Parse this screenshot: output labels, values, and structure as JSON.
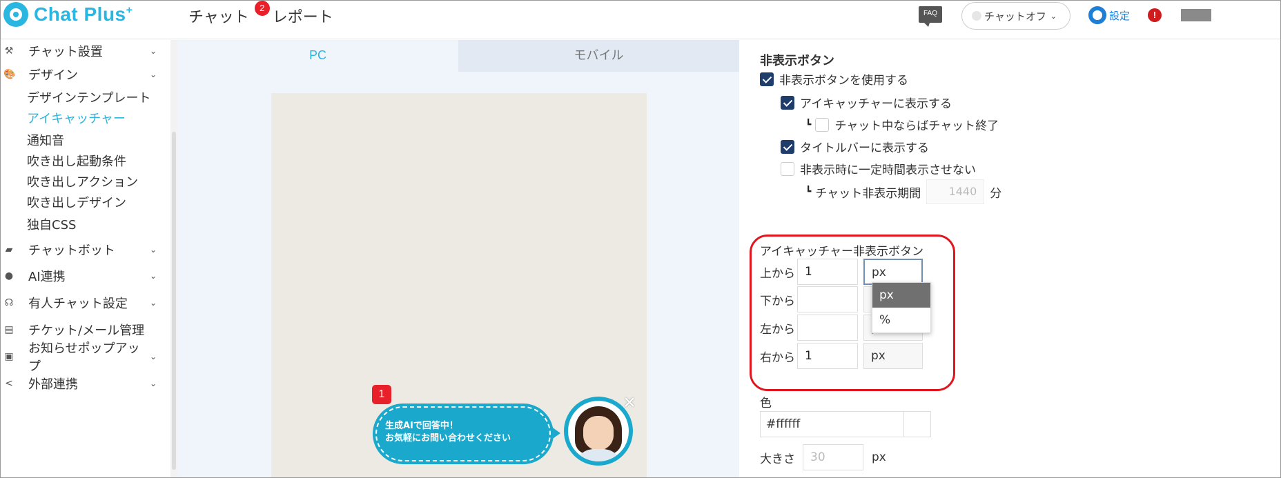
{
  "app": {
    "logo_text": "Chat Plus",
    "logo_plus": "+"
  },
  "header": {
    "nav": [
      {
        "label": "チャット",
        "badge": "2"
      },
      {
        "label": "レポート"
      }
    ],
    "faq": "FAQ",
    "chat_status": "チャットオフ",
    "settings_label": "設定",
    "alert": "!"
  },
  "sidebar": {
    "sections": [
      {
        "label": "チャット設置"
      },
      {
        "label": "デザイン"
      },
      {
        "label": "チャットボット"
      },
      {
        "label": "AI連携"
      },
      {
        "label": "有人チャット設定"
      },
      {
        "label": "チケット/メール管理"
      },
      {
        "label": "お知らせポップアップ"
      },
      {
        "label": "外部連携"
      }
    ],
    "design_items": [
      "デザインテンプレート",
      "アイキャッチャー",
      "通知音",
      "吹き出し起動条件",
      "吹き出しアクション",
      "吹き出しデザイン",
      "独自CSS"
    ]
  },
  "preview": {
    "tabs": [
      "PC",
      "モバイル"
    ],
    "badge": "1",
    "bubble_line1": "生成AIで回答中！",
    "bubble_line2": "お気軽にお問い合わせください",
    "close": "×"
  },
  "panel": {
    "title": "非表示ボタン",
    "use_hide_button": "非表示ボタンを使用する",
    "show_on_eyecatcher": "アイキャッチャーに表示する",
    "branch": "┗",
    "end_chat_if_active": "チャット中ならばチャット終了",
    "show_on_titlebar": "タイトルバーに表示する",
    "no_hide_period": "非表示時に一定時間表示させない",
    "hide_period_label": "チャット非表示期間",
    "hide_period_value": "1440",
    "hide_period_unit": "分",
    "eyecatcher_group": "アイキャッチャー非表示ボタン",
    "fields": [
      {
        "label": "上から",
        "value": "1",
        "unit": "px"
      },
      {
        "label": "下から",
        "value": "",
        "unit": "px"
      },
      {
        "label": "左から",
        "value": "",
        "unit": "px"
      },
      {
        "label": "右から",
        "value": "1",
        "unit": "px"
      }
    ],
    "unit_options": [
      "px",
      "%"
    ],
    "color_label": "色",
    "color_value": "#ffffff",
    "size_label": "大きさ",
    "size_placeholder": "30",
    "size_unit": "px"
  },
  "colors": {
    "brand": "#29b6e0",
    "checkbox_on": "#1f3d6b",
    "highlight": "#e0161f",
    "bubble": "#1aa8cc"
  }
}
